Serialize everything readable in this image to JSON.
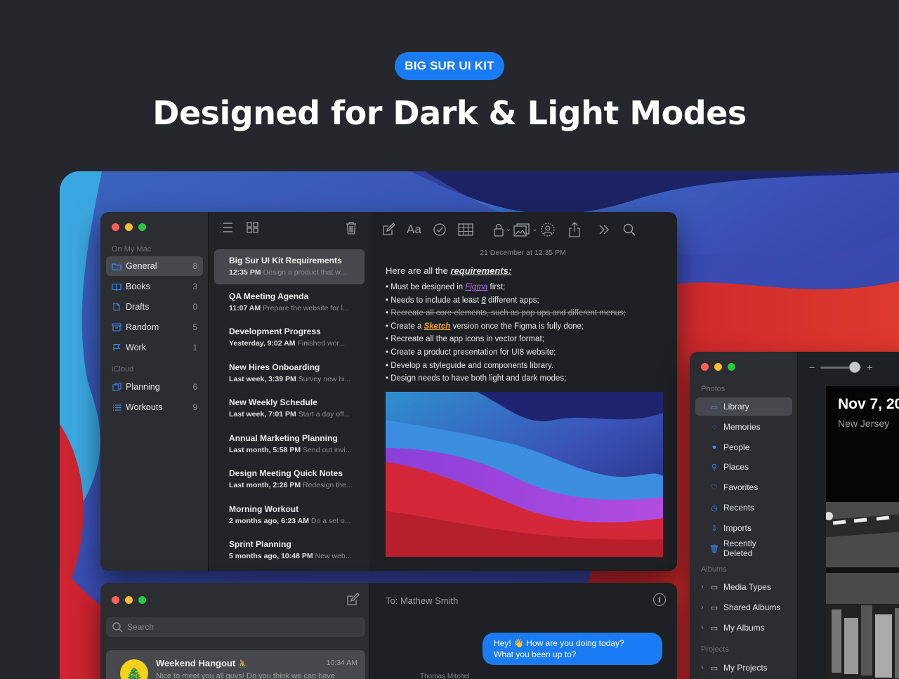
{
  "hero": {
    "badge": "BIG SUR UI KIT",
    "headline": "Designed for Dark & Light Modes"
  },
  "colors": {
    "background": "#25272d",
    "accent": "#1a7cf5",
    "window": "#1f2023",
    "sidebar": "#2c2d31",
    "selection": "#48494e"
  },
  "notes_app": {
    "sections": {
      "on_my_mac": "On My Mac",
      "icloud": "iCloud"
    },
    "folders": [
      {
        "label": "General",
        "count": "8",
        "icon": "folder-icon"
      },
      {
        "label": "Books",
        "count": "3",
        "icon": "book-icon"
      },
      {
        "label": "Drafts",
        "count": "0",
        "icon": "document-icon"
      },
      {
        "label": "Random",
        "count": "5",
        "icon": "archive-icon"
      },
      {
        "label": "Work",
        "count": "1",
        "icon": "flag-icon"
      }
    ],
    "icloud_folders": [
      {
        "label": "Planning",
        "count": "6",
        "icon": "copy-icon"
      },
      {
        "label": "Workouts",
        "count": "9",
        "icon": "list-icon"
      }
    ],
    "notes": [
      {
        "title": "Big Sur UI Kit Requirements",
        "time": "12:35 PM",
        "preview": "Design a product that w..."
      },
      {
        "title": "QA Meeting Agenda",
        "time": "11:07 AM",
        "preview": "Prepare the website for l..."
      },
      {
        "title": "Development Progress",
        "time": "Yesterday, 9:02 AM",
        "preview": "Finished wor..."
      },
      {
        "title": "New Hires Onboarding",
        "time": "Last week, 3:39 PM",
        "preview": "Survey new hi..."
      },
      {
        "title": "New Weekly Schedule",
        "time": "Last week, 7:01 PM",
        "preview": "Start a day off..."
      },
      {
        "title": "Annual Marketing Planning",
        "time": "Last month, 5:58 PM",
        "preview": "Send out invi..."
      },
      {
        "title": "Design Meeting Quick Notes",
        "time": "Last month, 2:26 PM",
        "preview": "Redesign the..."
      },
      {
        "title": "Morning Workout",
        "time": "2 months ago, 6:23 AM",
        "preview": "Do a set o..."
      },
      {
        "title": "Sprint Planning",
        "time": "5 months ago, 10:48 PM",
        "preview": "New web..."
      }
    ],
    "editor": {
      "date": "21 December at 12:35 PM",
      "heading_prefix": "Here are all the ",
      "heading_emph": "requirements:",
      "b1_a": "Must be designed in ",
      "b1_link": "Figma",
      "b1_b": " first;",
      "b2_a": "Needs to include at least ",
      "b2_num": "8",
      "b2_b": " different apps;",
      "b3": "Recreate all core elements, such as pop ups and different menus;",
      "b4_a": "Create a ",
      "b4_link": "Sketch",
      "b4_b": " version once the Figma is fully done;",
      "b5": "Recreate all the app icons in vector format;",
      "b6": "Create a product presentation for UI8 website;",
      "b7": "Develop a styleguide and components library.",
      "b8": "Design needs to have both light and dark modes;"
    }
  },
  "photos_app": {
    "sections": {
      "photos": "Photos",
      "albums": "Albums",
      "projects": "Projects"
    },
    "items": [
      {
        "label": "Library"
      },
      {
        "label": "Memories"
      },
      {
        "label": "People"
      },
      {
        "label": "Places"
      },
      {
        "label": "Favorites"
      },
      {
        "label": "Recents"
      },
      {
        "label": "Imports"
      },
      {
        "label": "Recently Deleted"
      }
    ],
    "albums": [
      {
        "label": "Media Types"
      },
      {
        "label": "Shared Albums"
      },
      {
        "label": "My Albums"
      }
    ],
    "projects": [
      {
        "label": "My Projects"
      }
    ],
    "zoom": {
      "minus": "−",
      "plus": "+",
      "level": 0.85
    },
    "photo": {
      "date": "Nov 7, 20",
      "location": "New Jersey"
    }
  },
  "messages_app": {
    "search_placeholder": "Search",
    "conversation": {
      "name": "Weekend Hangout",
      "time": "10:34 AM",
      "preview": "Nice to meet you all guys! Do you think we can have"
    },
    "to_line": "To: Mathew Smith",
    "bubble_line1": "Hey! 👋 How are you doing today?",
    "bubble_line2": "What you been up to?",
    "sender": "Thomas Mitchel"
  }
}
